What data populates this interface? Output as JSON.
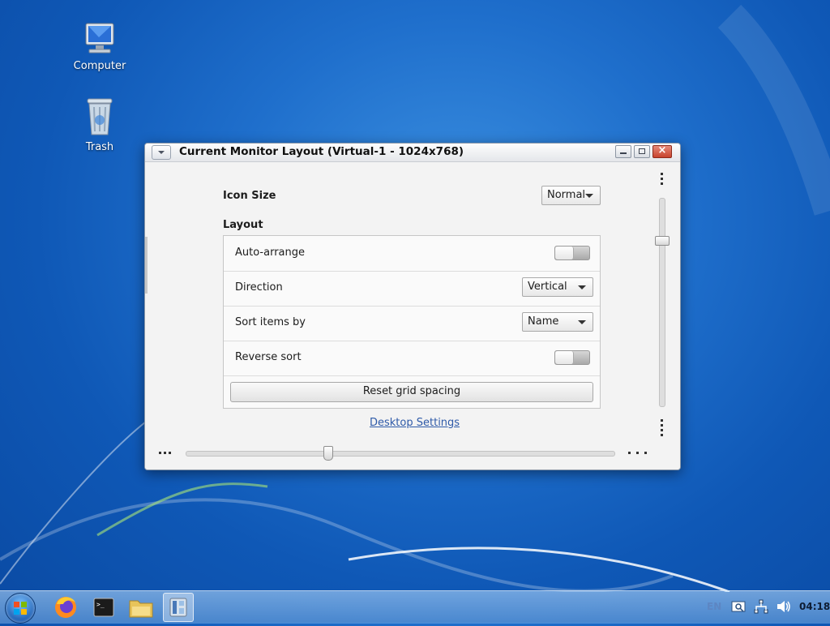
{
  "desktop": {
    "icons": [
      {
        "label": "Computer",
        "icon": "computer-icon"
      },
      {
        "label": "Trash",
        "icon": "trash-icon"
      }
    ]
  },
  "window": {
    "title": "Current Monitor Layout (Virtual-1 - 1024x768)",
    "icon_size": {
      "label": "Icon Size",
      "value": "Normal"
    },
    "layout": {
      "heading": "Layout",
      "auto_arrange": {
        "label": "Auto-arrange",
        "enabled": false
      },
      "direction": {
        "label": "Direction",
        "value": "Vertical"
      },
      "sort_by": {
        "label": "Sort items by",
        "value": "Name"
      },
      "reverse_sort": {
        "label": "Reverse sort",
        "enabled": false
      },
      "reset_button": "Reset grid spacing"
    },
    "settings_link": "Desktop Settings"
  },
  "taskbar": {
    "items": [
      "start-menu-icon",
      "firefox-icon",
      "terminal-icon",
      "file-manager-icon",
      "desktop-settings-icon"
    ],
    "tray": {
      "language": "EN",
      "clock": "04:18"
    }
  },
  "colors": {
    "desktop_bg": "#1f6fcc",
    "link": "#2e5aa8",
    "close_button": "#c8432e"
  }
}
